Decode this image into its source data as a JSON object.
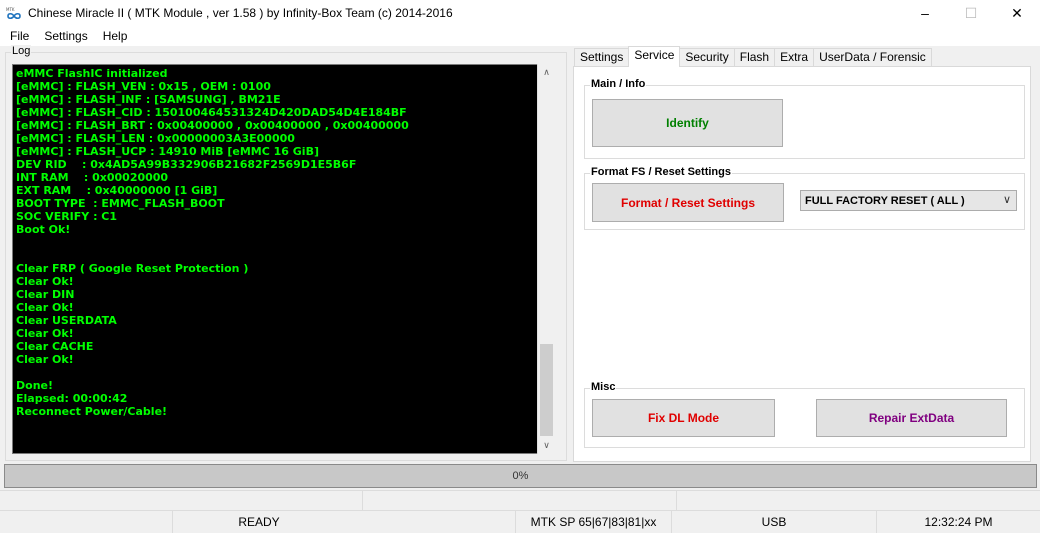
{
  "window": {
    "title": "Chinese Miracle II ( MTK Module , ver 1.58 ) by Infinity-Box Team (c) 2014-2016",
    "icon_name": "infinity-box-icon",
    "minimize": "–",
    "maximize": "☐",
    "close": "✕"
  },
  "menu": {
    "items": [
      "File",
      "Settings",
      "Help"
    ]
  },
  "log": {
    "label": "Log",
    "text_color": "#00ff00",
    "lines": [
      "eMMC FlashIC initialized",
      "[eMMC] : FLASH_VEN : 0x15 , OEM : 0100",
      "[eMMC] : FLASH_INF : [SAMSUNG] , BM21E",
      "[eMMC] : FLASH_CID : 150100464531324D420DAD54D4E184BF",
      "[eMMC] : FLASH_BRT : 0x00400000 , 0x00400000 , 0x00400000",
      "[eMMC] : FLASH_LEN : 0x00000003A3E00000",
      "[eMMC] : FLASH_UCP : 14910 MiB [eMMC 16 GiB]",
      "DEV RID    : 0x4AD5A99B332906B21682F2569D1E5B6F",
      "INT RAM    : 0x00020000",
      "EXT RAM    : 0x40000000 [1 GiB]",
      "BOOT TYPE  : EMMC_FLASH_BOOT",
      "SOC VERIFY : C1",
      "Boot Ok!",
      "",
      "",
      "Clear FRP ( Google Reset Protection )",
      "Clear Ok!",
      "Clear DIN",
      "Clear Ok!",
      "Clear USERDATA",
      "Clear Ok!",
      "Clear CACHE",
      "Clear Ok!",
      "",
      "Done!",
      "Elapsed: 00:00:42",
      "Reconnect Power/Cable!"
    ],
    "scroll_up": "∧",
    "scroll_down": "∨"
  },
  "tabs": {
    "items": [
      "Settings",
      "Service",
      "Security",
      "Flash",
      "Extra",
      "UserData / Forensic"
    ],
    "active": "Service"
  },
  "service": {
    "main_info": {
      "title": "Main / Info",
      "identify_label": "Identify",
      "identify_color": "#008000"
    },
    "format": {
      "title": "Format FS / Reset Settings",
      "button_label": "Format / Reset Settings",
      "button_color": "#e00000",
      "select_value": "FULL FACTORY RESET ( ALL )"
    },
    "misc": {
      "title": "Misc",
      "fix_dl_label": "Fix DL Mode",
      "fix_dl_color": "#e00000",
      "repair_label": "Repair ExtData",
      "repair_color": "#800080"
    }
  },
  "progress": {
    "value": 0,
    "label": "0%"
  },
  "status": {
    "state": "READY",
    "platform": "MTK SP 65|67|83|81|xx",
    "port": "USB",
    "time": "12:32:24 PM"
  }
}
